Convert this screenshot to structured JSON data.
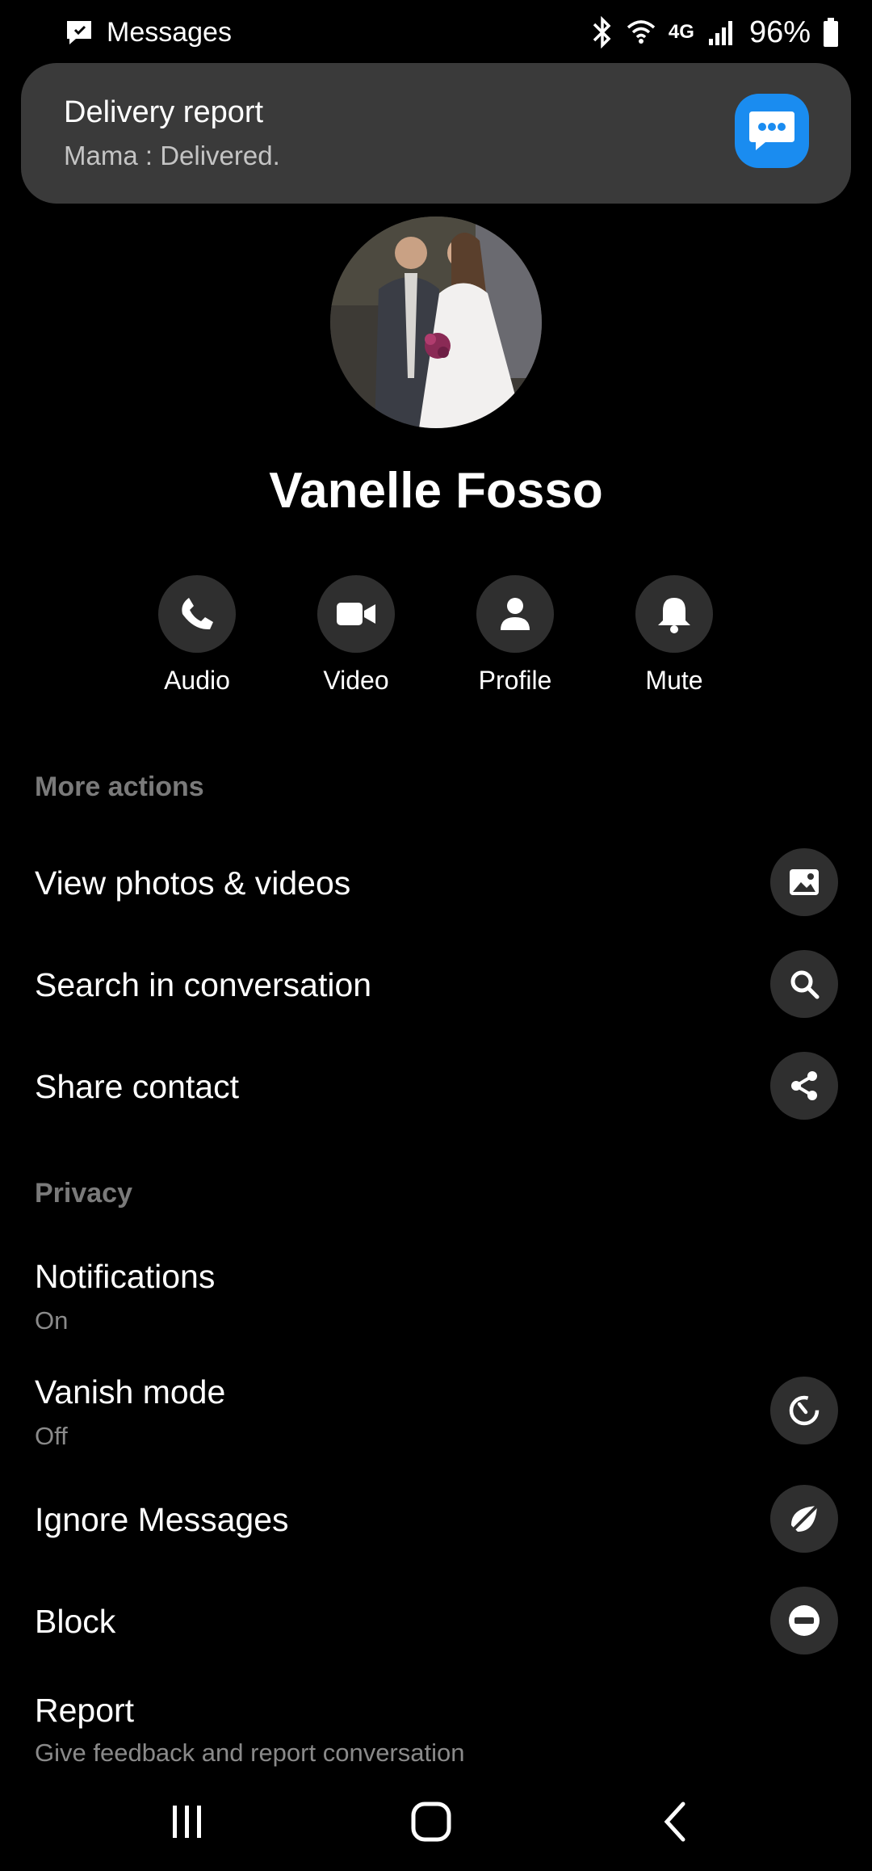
{
  "status_bar": {
    "app_name": "Messages",
    "network": "4G",
    "battery": "96%"
  },
  "notification": {
    "title": "Delivery report",
    "body": "Mama : Delivered.",
    "icon": "chat-bubble-icon",
    "accent": "#1a8cf0"
  },
  "contact": {
    "name": "Vanelle Fosso"
  },
  "quick_actions": [
    {
      "label": "Audio",
      "icon": "phone-icon"
    },
    {
      "label": "Video",
      "icon": "video-camera-icon"
    },
    {
      "label": "Profile",
      "icon": "person-icon"
    },
    {
      "label": "Mute",
      "icon": "bell-icon"
    }
  ],
  "sections": {
    "more_actions": {
      "header": "More actions",
      "items": [
        {
          "title": "View photos & videos",
          "icon": "image-icon"
        },
        {
          "title": "Search in conversation",
          "icon": "search-icon"
        },
        {
          "title": "Share contact",
          "icon": "share-icon"
        }
      ]
    },
    "privacy": {
      "header": "Privacy",
      "items": [
        {
          "title": "Notifications",
          "subtitle": "On"
        },
        {
          "title": "Vanish mode",
          "subtitle": "Off",
          "icon": "vanish-mode-icon"
        },
        {
          "title": "Ignore Messages",
          "icon": "ignore-icon"
        },
        {
          "title": "Block",
          "icon": "block-icon"
        },
        {
          "title": "Report",
          "subtitle": "Give feedback and report conversation"
        }
      ]
    }
  },
  "nav_bar": {
    "buttons": [
      "recent-apps-icon",
      "home-icon",
      "back-icon"
    ]
  }
}
